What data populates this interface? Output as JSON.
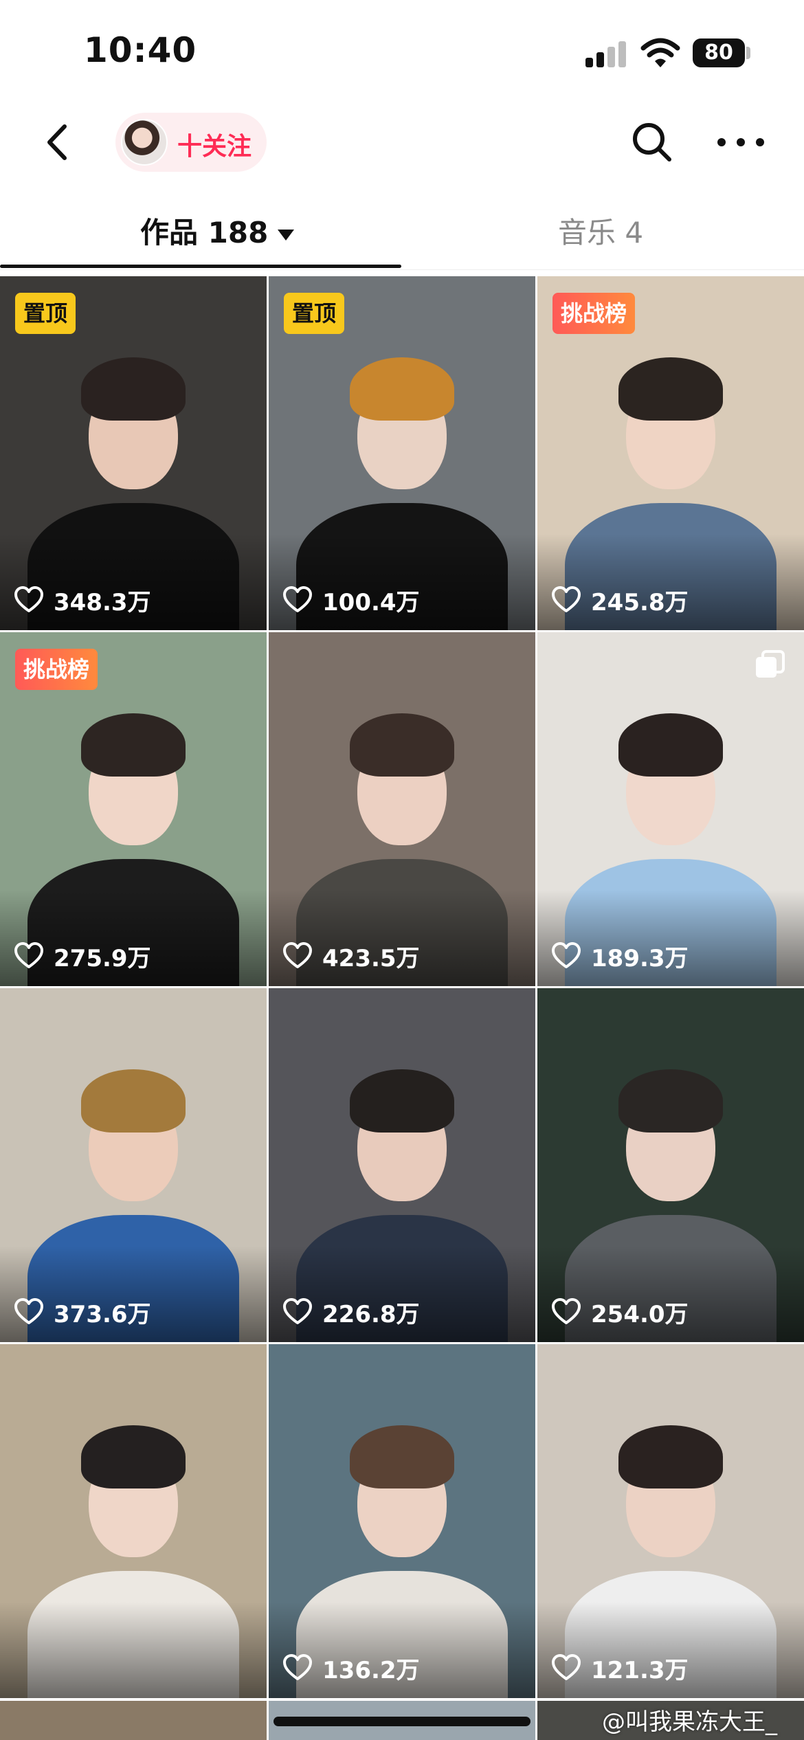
{
  "status_bar": {
    "time": "10:40",
    "battery": "80"
  },
  "header": {
    "follow_label": "十关注",
    "icons": [
      "back-icon",
      "avatar",
      "search-icon",
      "more-icon"
    ]
  },
  "tabs": [
    {
      "label": "作品 188",
      "active": true
    },
    {
      "label": "音乐 4",
      "active": false
    }
  ],
  "videos": [
    {
      "likes": "348.3万",
      "badge": "置顶",
      "badge_type": "pinned",
      "colors": {
        "bg": "#3c3a38",
        "hair": "#2a2220",
        "skin": "#e8c8b6",
        "body": "#111111"
      }
    },
    {
      "likes": "100.4万",
      "badge": "置顶",
      "badge_type": "pinned",
      "colors": {
        "bg": "#6f7478",
        "hair": "#c8862e",
        "skin": "#e9d2c4",
        "body": "#141414"
      }
    },
    {
      "likes": "245.8万",
      "badge": "挑战榜",
      "badge_type": "challenge",
      "colors": {
        "bg": "#d9cbb8",
        "hair": "#2b2420",
        "skin": "#efd4c4",
        "body": "#5b7594"
      }
    },
    {
      "likes": "275.9万",
      "badge": "挑战榜",
      "badge_type": "challenge",
      "colors": {
        "bg": "#8aa08a",
        "hair": "#2d2522",
        "skin": "#f0d6c8",
        "body": "#1c1c1c"
      }
    },
    {
      "likes": "423.5万",
      "badge": "",
      "badge_type": "",
      "colors": {
        "bg": "#7c7068",
        "hair": "#3a2d28",
        "skin": "#ecd0c2",
        "body": "#4a4844"
      }
    },
    {
      "likes": "189.3万",
      "badge": "",
      "badge_type": "",
      "multi": true,
      "colors": {
        "bg": "#e4e1dc",
        "hair": "#2a2220",
        "skin": "#f0d8cc",
        "body": "#9ec3e4"
      }
    },
    {
      "likes": "373.6万",
      "badge": "",
      "badge_type": "",
      "colors": {
        "bg": "#c9c2b6",
        "hair": "#a37a3c",
        "skin": "#ecccba",
        "body": "#2f62a8"
      }
    },
    {
      "likes": "226.8万",
      "badge": "",
      "badge_type": "",
      "colors": {
        "bg": "#55555a",
        "hair": "#24201e",
        "skin": "#e8cbbc",
        "body": "#2a3446"
      }
    },
    {
      "likes": "254.0万",
      "badge": "",
      "badge_type": "",
      "colors": {
        "bg": "#2c3a32",
        "hair": "#2a2624",
        "skin": "#e9d0c4",
        "body": "#5a5e62"
      }
    },
    {
      "likes": "",
      "badge": "",
      "badge_type": "",
      "colors": {
        "bg": "#b9ab94",
        "hair": "#242020",
        "skin": "#efd6c8",
        "body": "#ece8e2"
      }
    },
    {
      "likes": "136.2万",
      "badge": "",
      "badge_type": "",
      "colors": {
        "bg": "#5c7480",
        "hair": "#5a4234",
        "skin": "#ecd2c4",
        "body": "#e6e2dc"
      }
    },
    {
      "likes": "121.3万",
      "badge": "",
      "badge_type": "",
      "colors": {
        "bg": "#cfc7bd",
        "hair": "#2a2220",
        "skin": "#ecd2c4",
        "body": "#eeeeee"
      }
    }
  ],
  "watermark": "@叫我果冻大王_"
}
